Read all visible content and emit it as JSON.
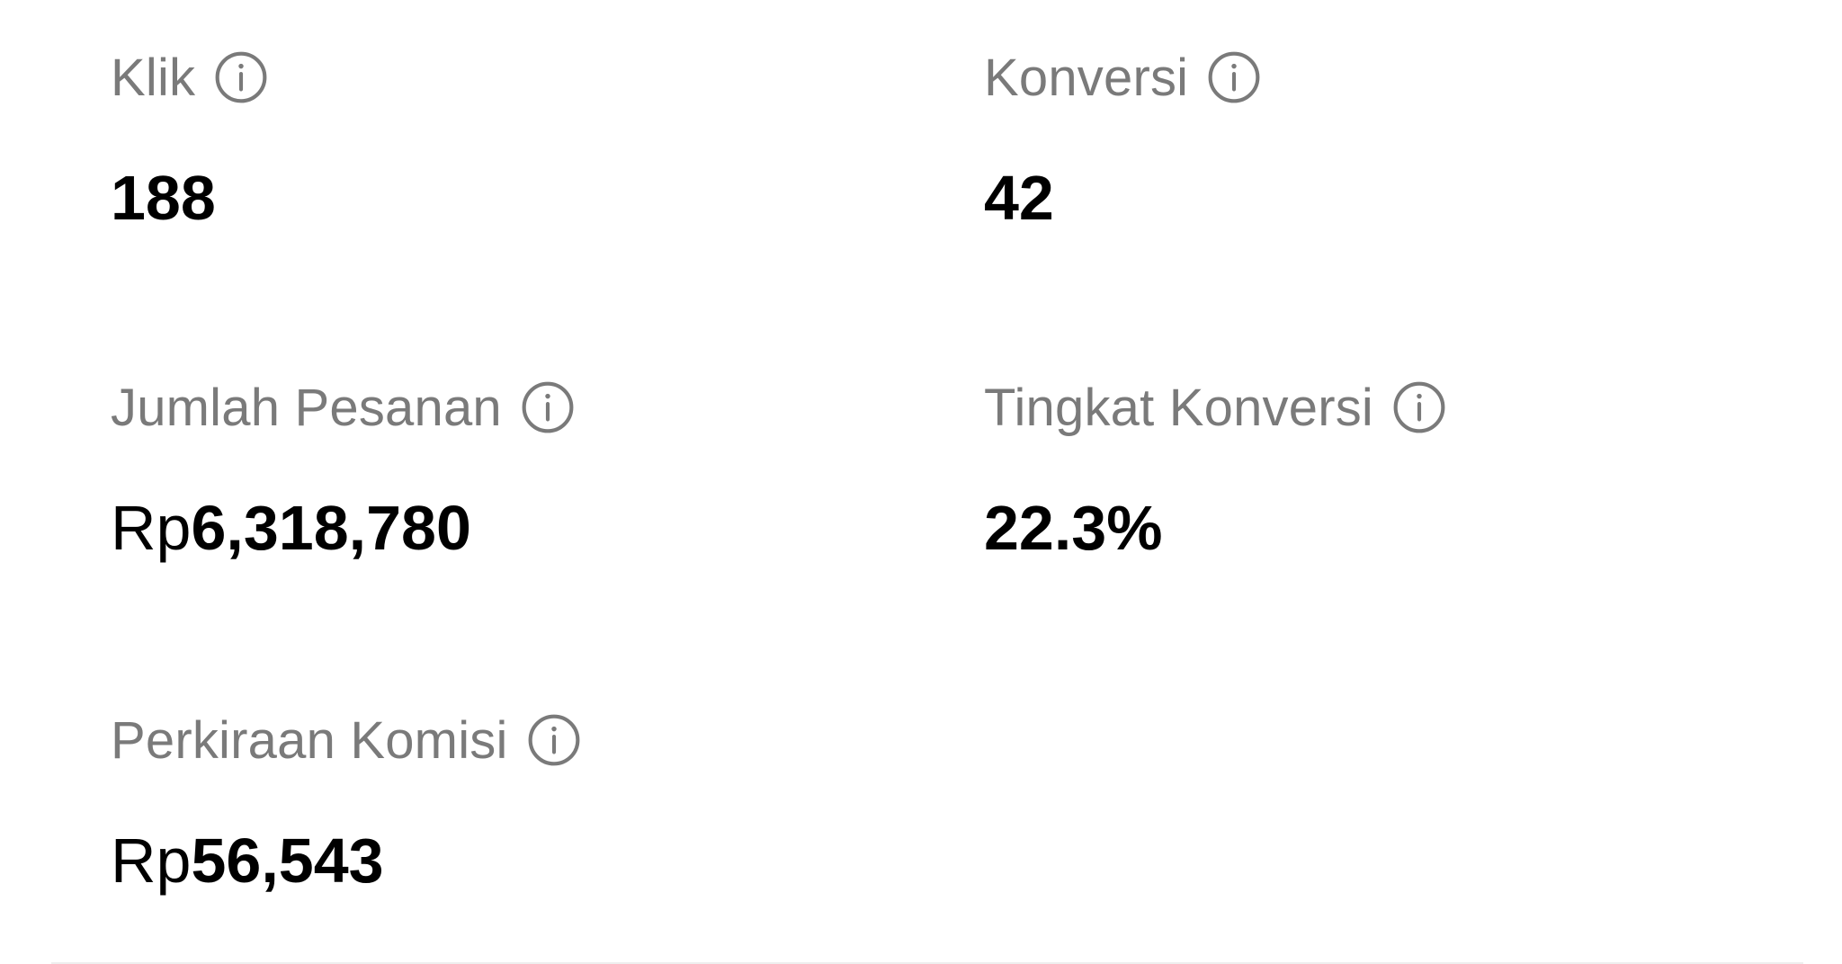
{
  "stats": [
    {
      "label": "Klik",
      "prefix": "",
      "value": "188"
    },
    {
      "label": "Konversi",
      "prefix": "",
      "value": "42"
    },
    {
      "label": "Jumlah Pesanan",
      "prefix": "Rp",
      "value": "6,318,780"
    },
    {
      "label": "Tingkat Konversi",
      "prefix": "",
      "value": "22.3%"
    },
    {
      "label": "Perkiraan Komisi",
      "prefix": "Rp",
      "value": "56,543"
    }
  ],
  "icons": {
    "info": "info-circle-icon"
  },
  "colors": {
    "label": "#7a7a7a",
    "value": "#000000",
    "divider": "#eeeeee"
  }
}
